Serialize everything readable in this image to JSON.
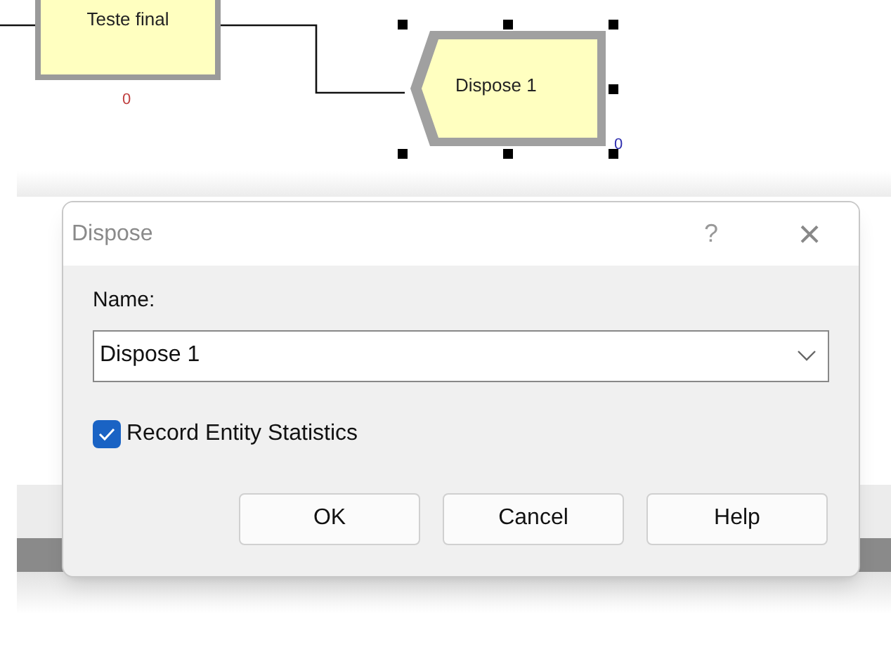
{
  "canvas": {
    "modules": [
      {
        "kind": "process",
        "label": "Teste final",
        "count": "0",
        "selected": false
      },
      {
        "kind": "dispose",
        "label": "Dispose 1",
        "count": "0",
        "selected": true
      }
    ]
  },
  "dialog": {
    "title": "Dispose",
    "help_glyph": "?",
    "close_glyph": "×",
    "name_label": "Name:",
    "name_value": "Dispose 1",
    "record_stats": {
      "label": "Record Entity Statistics",
      "checked": true
    },
    "buttons": [
      "OK",
      "Cancel",
      "Help"
    ]
  }
}
